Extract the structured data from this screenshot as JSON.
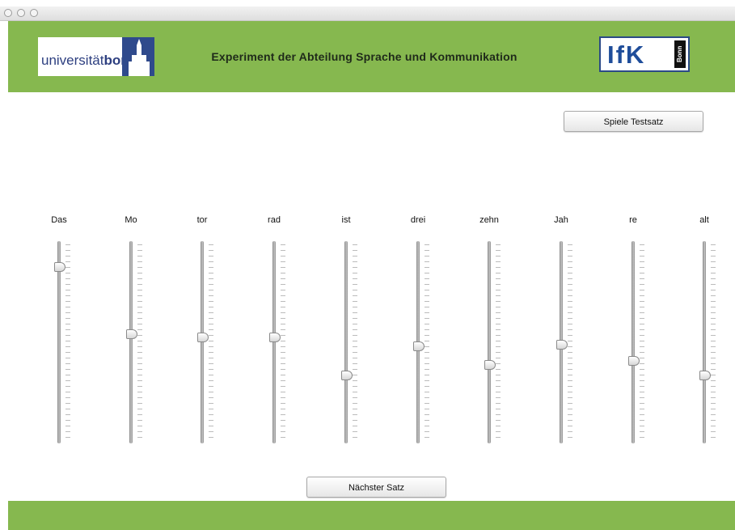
{
  "header": {
    "university_logo_prefix": "universität",
    "university_logo_bold": "bonn",
    "title": "Experiment der Abteilung Sprache und Kommunikation",
    "ifk_logo_text": "IfK",
    "ifk_logo_sub": "Bonn"
  },
  "buttons": {
    "play_test": "Spiele Testsatz",
    "next": "Nächster Satz"
  },
  "sliders": [
    {
      "label": "Das",
      "value": 0.92
    },
    {
      "label": "Mo",
      "value": 0.55
    },
    {
      "label": "tor",
      "value": 0.53
    },
    {
      "label": "rad",
      "value": 0.53
    },
    {
      "label": "ist",
      "value": 0.32
    },
    {
      "label": "drei",
      "value": 0.48
    },
    {
      "label": "zehn",
      "value": 0.38
    },
    {
      "label": "Jah",
      "value": 0.49
    },
    {
      "label": "re",
      "value": 0.4
    },
    {
      "label": "alt",
      "value": 0.32
    }
  ],
  "colors": {
    "header_green": "#86b84f",
    "logo_blue": "#1f4d9a"
  }
}
